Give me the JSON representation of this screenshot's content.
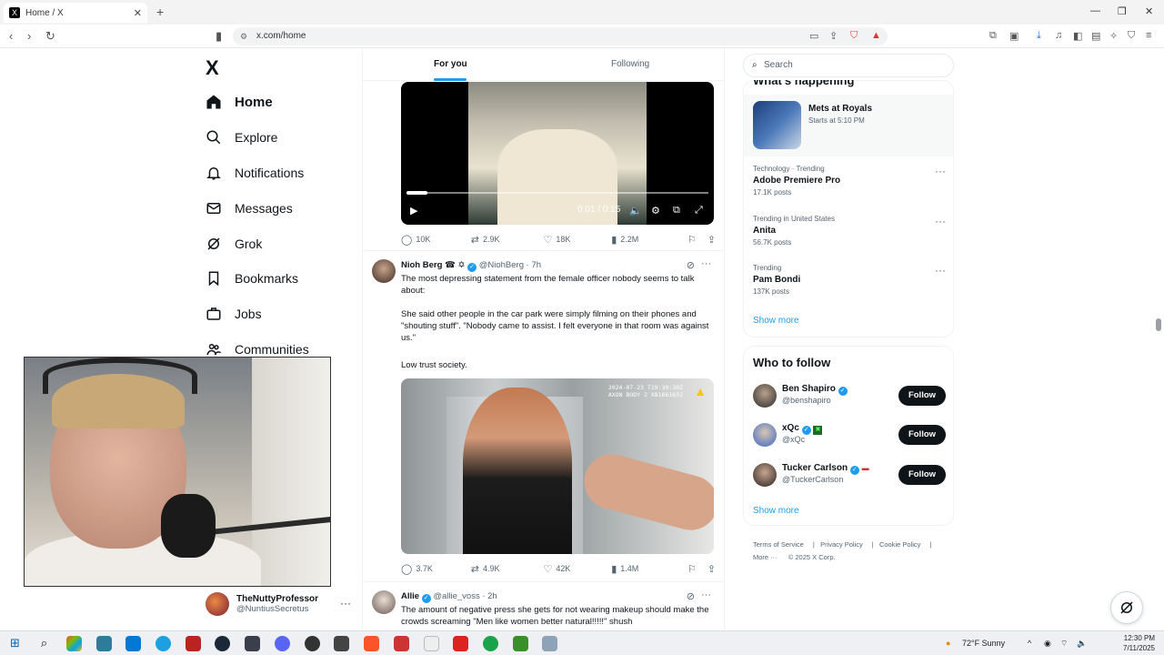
{
  "browser": {
    "tab_title": "Home / X",
    "tab_favicon": "x-icon",
    "url": "x.com/home"
  },
  "sidebar": {
    "logo": "X",
    "items": [
      {
        "label": "Home",
        "icon": "home-icon",
        "active": true
      },
      {
        "label": "Explore",
        "icon": "search-icon"
      },
      {
        "label": "Notifications",
        "icon": "bell-icon"
      },
      {
        "label": "Messages",
        "icon": "mail-icon"
      },
      {
        "label": "Grok",
        "icon": "grok-icon"
      },
      {
        "label": "Bookmarks",
        "icon": "bookmark-icon"
      },
      {
        "label": "Jobs",
        "icon": "briefcase-icon"
      },
      {
        "label": "Communities",
        "icon": "people-icon"
      }
    ],
    "profile": {
      "name": "TheNuttyProfessor",
      "handle": "@NuntiusSecretus",
      "more": "···"
    }
  },
  "feed": {
    "tabs": [
      {
        "label": "For you",
        "active": true
      },
      {
        "label": "Following",
        "active": false
      }
    ],
    "video_post": {
      "time": "0:01 / 0:15",
      "progress": 0.07,
      "stats": {
        "replies": "10K",
        "reposts": "2.9K",
        "likes": "18K",
        "views": "2.2M"
      }
    },
    "post1": {
      "name": "Nioh Berg",
      "badges": "☎ ✡",
      "handle": "@NiohBerg",
      "time": "· 7h",
      "text1": "The most depressing statement from the female officer nobody seems to talk about:",
      "text2": "She said other people in the car park were simply filming on their phones and \"shouting stuff\". \"Nobody came to assist. I felt everyone in that room was against us.\"",
      "text3": "Low trust society.",
      "image_stamp1": "2024-07-23 T19:30:30Z",
      "image_stamp2": "AXON BODY 2 X81661632",
      "stats": {
        "replies": "3.7K",
        "reposts": "4.9K",
        "likes": "42K",
        "views": "1.4M"
      }
    },
    "post2": {
      "name": "Allie",
      "handle": "@allie_voss",
      "time": "· 2h",
      "text": "The amount of negative press she gets for not wearing makeup should make the crowds screaming \"Men like women better natural!!!!!\" shush"
    }
  },
  "right": {
    "search_placeholder": "Search",
    "whats_happening_title": "What's happening",
    "event": {
      "title": "Mets at Royals",
      "subtitle": "Starts at 5:10 PM"
    },
    "trends": [
      {
        "context": "Technology · Trending",
        "name": "Adobe Premiere Pro",
        "posts": "17.1K posts"
      },
      {
        "context": "Trending in United States",
        "name": "Anita",
        "posts": "56.7K posts"
      },
      {
        "context": "Trending",
        "name": "Pam Bondi",
        "posts": "137K posts"
      }
    ],
    "show_more": "Show more",
    "who_to_follow_title": "Who to follow",
    "who": [
      {
        "name": "Ben Shapiro",
        "handle": "@benshapiro",
        "button": "Follow"
      },
      {
        "name": "xQc",
        "handle": "@xQc",
        "button": "Follow"
      },
      {
        "name": "Tucker Carlson",
        "handle": "@TuckerCarlson",
        "button": "Follow"
      }
    ],
    "footer": {
      "terms": "Terms of Service",
      "privacy": "Privacy Policy",
      "cookie": "Cookie Policy",
      "more": "More ···",
      "copyright": "© 2025 X Corp."
    }
  },
  "taskbar": {
    "weather": "72°F  Sunny",
    "time": "12:30 PM",
    "date": "7/11/2025"
  },
  "colors": {
    "accent": "#1d9bf0",
    "text": "#0f1419",
    "muted": "#536471"
  }
}
